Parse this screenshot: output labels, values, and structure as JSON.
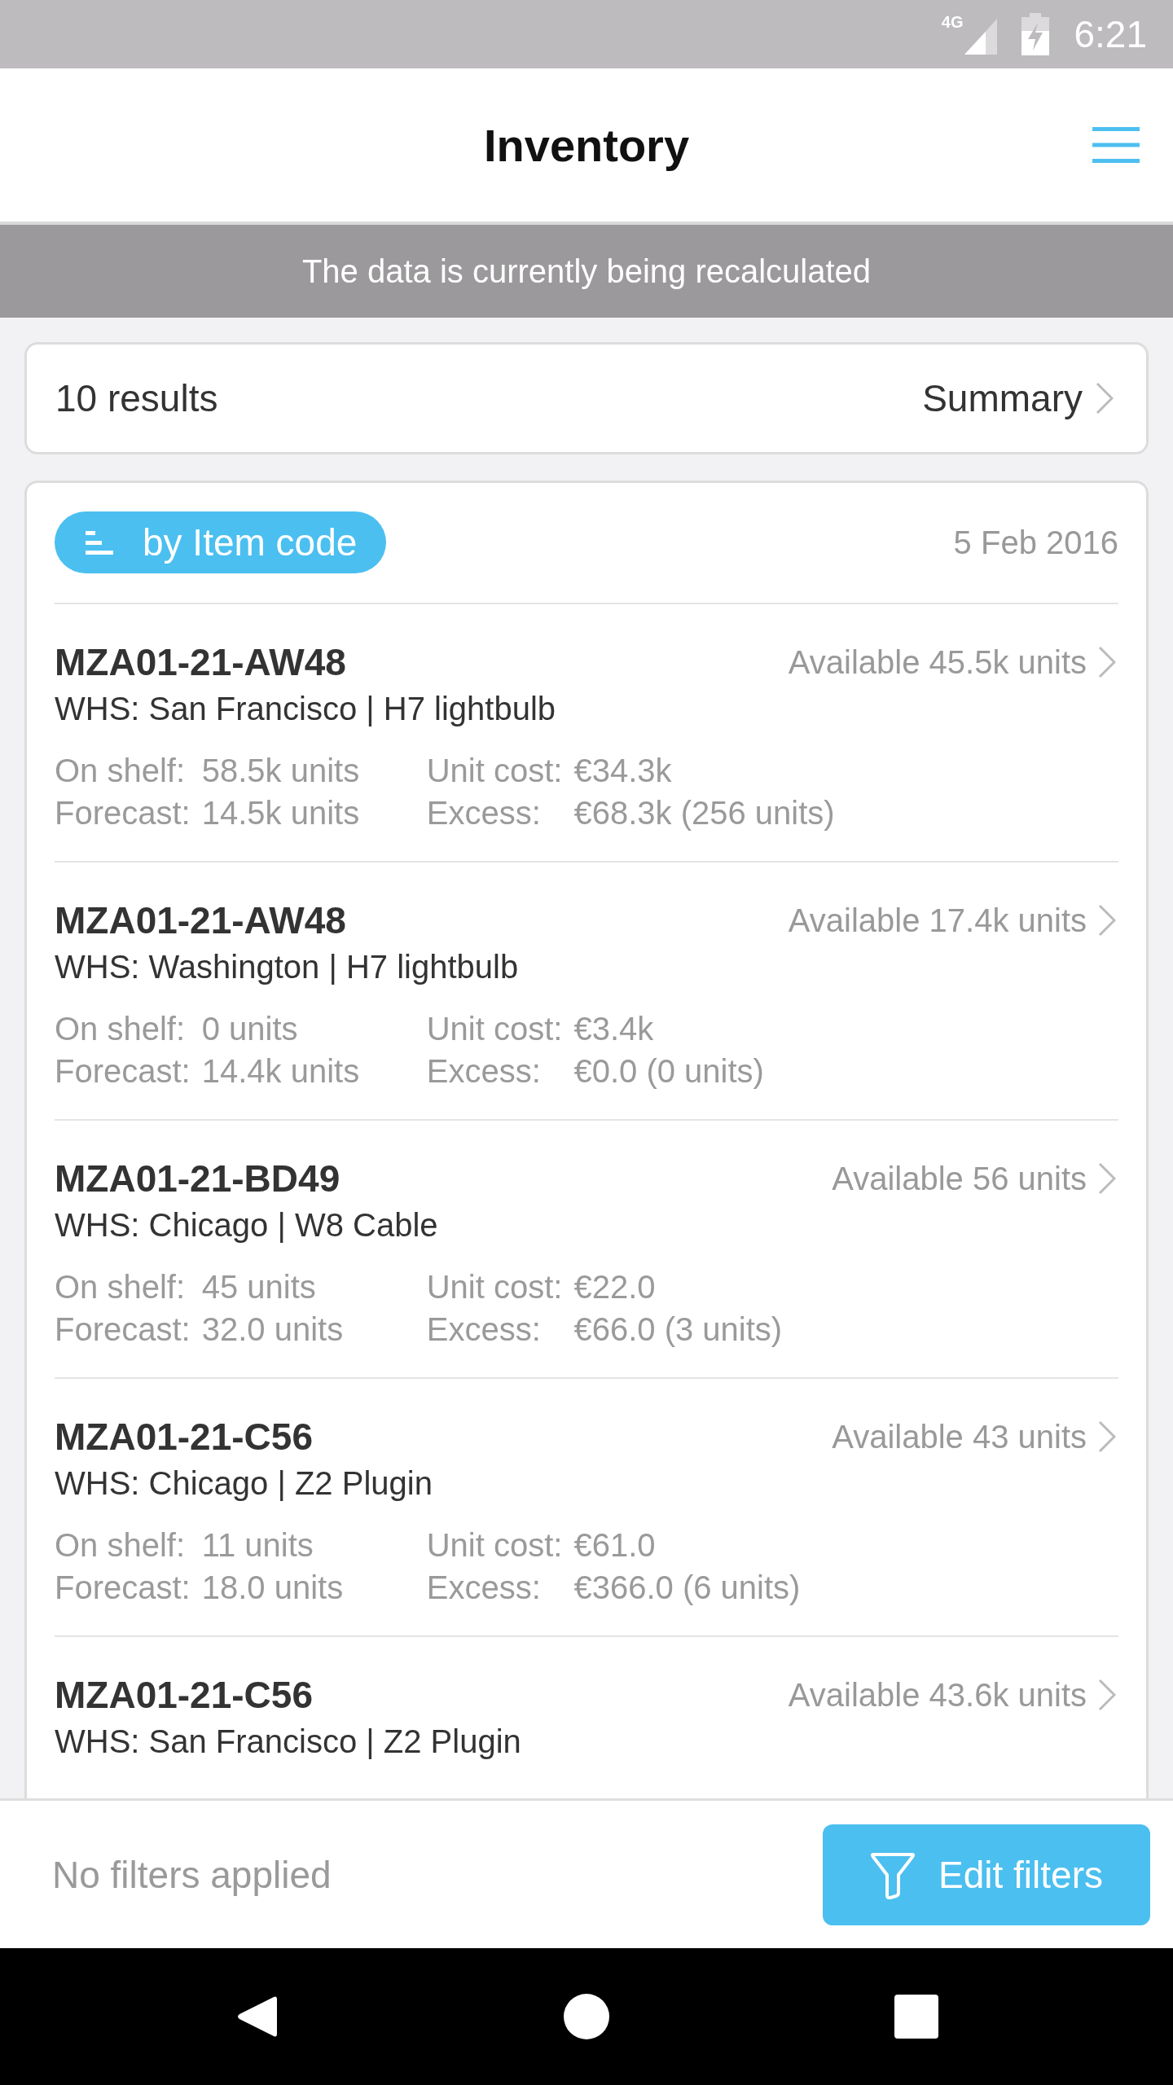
{
  "status_bar": {
    "network": "4G",
    "time": "6:21"
  },
  "header": {
    "title": "Inventory"
  },
  "banner": {
    "text": "The data is currently being recalculated"
  },
  "summary_card": {
    "results": "10 results",
    "link": "Summary"
  },
  "list": {
    "sort_chip": "by Item code",
    "date": "5 Feb 2016",
    "items": [
      {
        "code": "MZA01-21-AW48",
        "location": "WHS: San Francisco | H7 lightbulb",
        "available": "Available 45.5k units",
        "stats": [
          {
            "label": "On shelf:",
            "value": "58.5k units"
          },
          {
            "label": "Unit cost:",
            "value": "€34.3k"
          },
          {
            "label": "Forecast:",
            "value": "14.5k units"
          },
          {
            "label": "Excess:",
            "value": "€68.3k (256 units)"
          }
        ]
      },
      {
        "code": "MZA01-21-AW48",
        "location": "WHS: Washington | H7 lightbulb",
        "available": "Available 17.4k units",
        "stats": [
          {
            "label": "On shelf:",
            "value": "0 units"
          },
          {
            "label": "Unit cost:",
            "value": "€3.4k"
          },
          {
            "label": "Forecast:",
            "value": "14.4k units"
          },
          {
            "label": "Excess:",
            "value": "€0.0 (0 units)"
          }
        ]
      },
      {
        "code": "MZA01-21-BD49",
        "location": "WHS: Chicago | W8 Cable",
        "available": "Available 56 units",
        "stats": [
          {
            "label": "On shelf:",
            "value": "45 units"
          },
          {
            "label": "Unit cost:",
            "value": "€22.0"
          },
          {
            "label": "Forecast:",
            "value": "32.0 units"
          },
          {
            "label": "Excess:",
            "value": "€66.0 (3 units)"
          }
        ]
      },
      {
        "code": "MZA01-21-C56",
        "location": "WHS: Chicago | Z2 Plugin",
        "available": "Available 43 units",
        "stats": [
          {
            "label": "On shelf:",
            "value": "11 units"
          },
          {
            "label": "Unit cost:",
            "value": "€61.0"
          },
          {
            "label": "Forecast:",
            "value": "18.0 units"
          },
          {
            "label": "Excess:",
            "value": "€366.0 (6 units)"
          }
        ]
      },
      {
        "code": "MZA01-21-C56",
        "location": "WHS: San Francisco | Z2 Plugin",
        "available": "Available 43.6k units"
      }
    ]
  },
  "filter_bar": {
    "status": "No filters applied",
    "button": "Edit filters"
  }
}
